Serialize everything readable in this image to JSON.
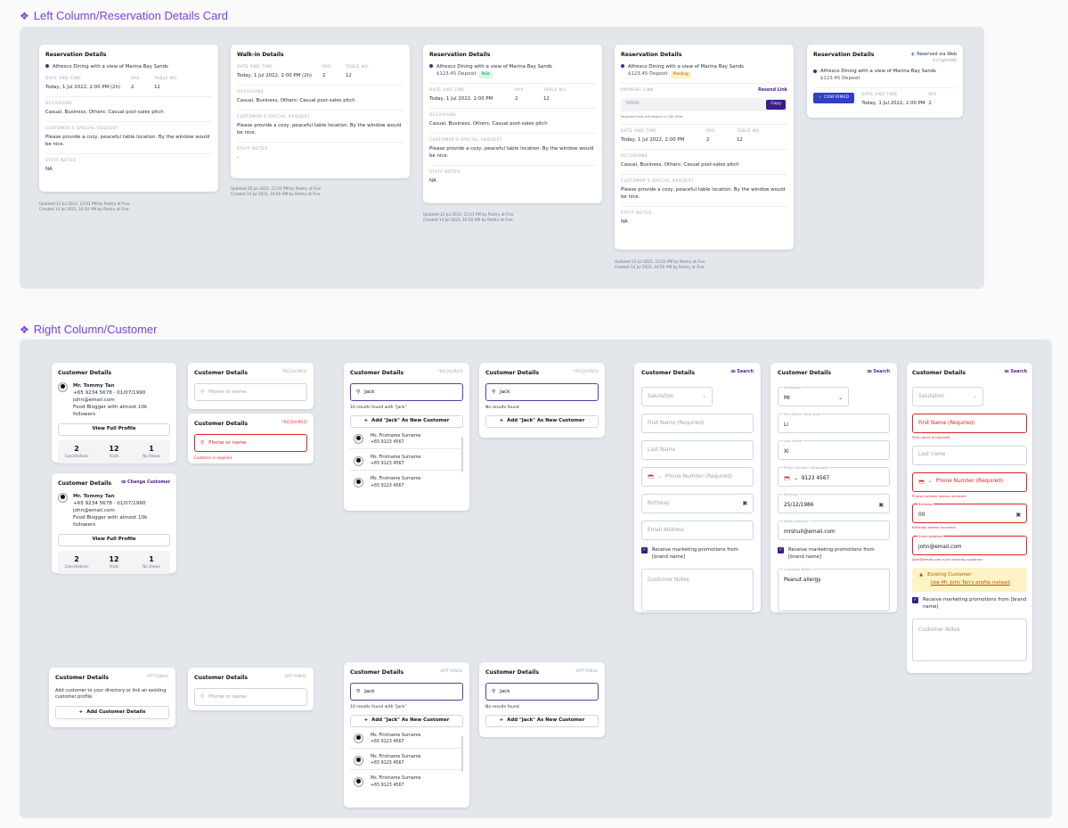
{
  "sections": {
    "left": "Left Column/Reservation Details Card",
    "right": "Right Column/Customer"
  },
  "labels": {
    "date_time": "DATE AND TIME",
    "pax": "PAX",
    "table_no": "TABLE NO.",
    "occasions": "OCCASIONS",
    "special_request": "CUSTOMER'S SPECIAL REQUEST",
    "staff_notes": "STAFF NOTES",
    "payment_link": "PAYMENT LINK"
  },
  "reservation": {
    "title": "Reservation Details",
    "walkin_title": "Walk-in Details",
    "item": "Alfresco Dining with a view of Marina Bay Sands",
    "deposit": "$123.45 Deposit",
    "paid": "Paid",
    "pending": "Pending",
    "date_2h": "Today, 1 Jul 2022, 2:00 PM (2h)",
    "date": "Today, 1 Jul 2022, 2:00 PM",
    "pax": "2",
    "table": "12",
    "occasions": "Casual, Business, Others: Casual post-sales pitch",
    "request": "Please provide a cozy, peaceful table location. By the window would be nice.",
    "notes_na": "NA",
    "notes_dash": "-",
    "updated": "Updated 22 Jul 2022, 12:01 PM by Pantry at Five",
    "created": "Created 14 Jul 2022, 10:50 AM by Pantry at Five",
    "updated_walkin": "Updated 25 Jul 2022, 12:01 PM by Pantry at Five",
    "created_walkin": "Created 14 Jul 2022, 10:50 AM by Pantry at Five",
    "resend": "Resend Link",
    "link_placeholder": "WWW.",
    "copy": "Copy",
    "link_expiry": "Payment link will expire in 10h 59m",
    "via_web": "Reserved via Web",
    "ref": "#310gbrhNfK",
    "confirmed": "CONFIRMED"
  },
  "customer": {
    "title": "Customer Details",
    "required": "*REQUIRED",
    "optional": "OPTIONAL",
    "search": "Search",
    "change": "Change Customer",
    "name": "Mr. Tommy Tan",
    "phone_dob": "+65 9234 5678 · 01/07/1990",
    "email": "john@email.com",
    "bio": "Food Blogger with almost 10k followers",
    "view_profile": "View Full Profile",
    "stats": [
      {
        "n": "2",
        "l": "Cancellations"
      },
      {
        "n": "12",
        "l": "Visits"
      },
      {
        "n": "1",
        "l": "No Shows"
      }
    ],
    "phone_or_name": "Phone or name",
    "customer_required": "Customer is required",
    "query": "Jack",
    "results_found": "10 results found with \"Jack\"",
    "no_results": "No results found",
    "add_as_new": "Add \"Jack\" As New Customer",
    "results": [
      {
        "name": "Ms. Firstname Surname",
        "phone": "+65 9123 4567"
      },
      {
        "name": "Ms. Firstname Surname",
        "phone": "+65 9123 4567"
      },
      {
        "name": "Ms. Firstname Surname",
        "phone": "+65 9123 4567"
      }
    ],
    "optional_desc": "Add customer to your directory or link an existing customer profile.",
    "add_customer": "Add Customer Details"
  },
  "form": {
    "salutation": "Salutation",
    "salutation_val": "Mr",
    "first_name_req": "First Name (Required)",
    "first_name_val": "Li",
    "last_name": "Last Name",
    "last_name_lc": "Last name",
    "last_name_val": "Xi",
    "phone_req": "Phone Number (Required)",
    "phone_val": "9123 4567",
    "birthday": "Birthday",
    "birthday_val": "25/12/1986",
    "birthday_err_val": "00",
    "email": "Email Address",
    "email_val": "mrshuli@email.com",
    "email_err_val": "john@email.com",
    "marketing": "Receive marketing promotions from [brand name]",
    "notes": "Customer Notes",
    "notes_val": "Peanut allergy",
    "err_first": "First name is required",
    "err_phone": "Phone number seems incorrect",
    "err_birthday": "Birthday seems incorrect",
    "err_email": "john@email.com is an existing customer",
    "existing": "Existing Customer",
    "use_profile": "Use Mr. John Tan's profile instead"
  }
}
